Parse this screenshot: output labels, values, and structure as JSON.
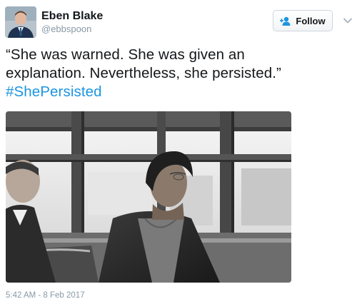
{
  "user": {
    "display_name": "Eben Blake",
    "handle": "@ebbspoon",
    "avatar_icon": "profile-photo"
  },
  "follow": {
    "label": "Follow",
    "icon": "add-person-icon",
    "accent": "#1b95e0"
  },
  "menu": {
    "icon": "chevron-down-icon"
  },
  "tweet": {
    "line1": "“She was warned. She was given an",
    "line2": "explanation. Nevertheless, she persisted.”",
    "hashtag": "#ShePersisted",
    "hashtag_color": "#1b95e0"
  },
  "media": {
    "description_icon": "bus-passenger-photo"
  },
  "meta": {
    "timestamp": "5:42 AM - 8 Feb 2017"
  }
}
